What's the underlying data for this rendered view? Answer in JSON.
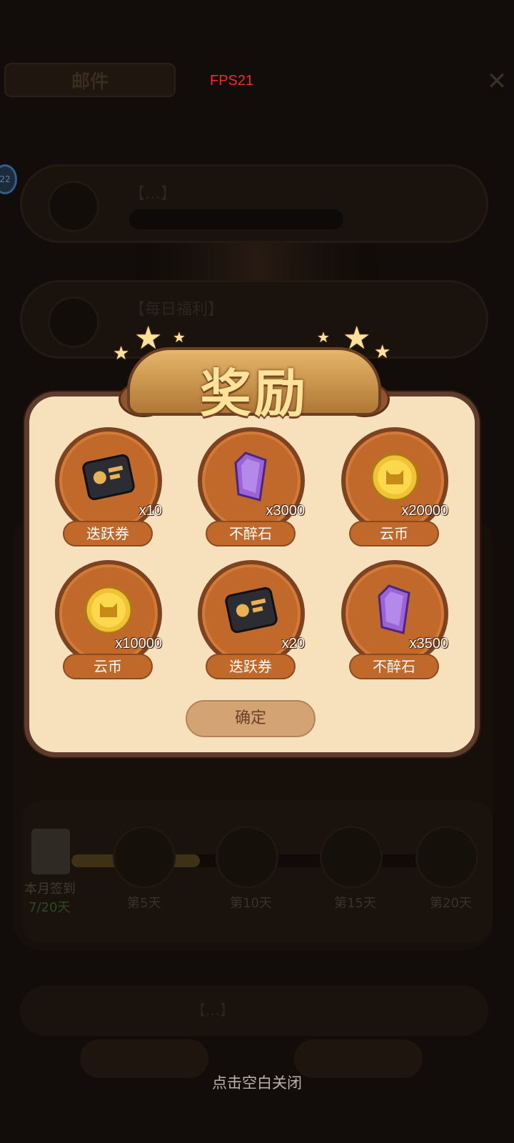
{
  "fps": "FPS21",
  "background": {
    "mail_tab": "邮件",
    "close_glyph": "✕",
    "badge": "22",
    "mail_rows": [
      {
        "title": "【…】"
      },
      {
        "title": "【每日福利】"
      }
    ],
    "signin": {
      "month_label": "本月签到",
      "count": "7/20天",
      "milestones": [
        "第5天",
        "第10天",
        "第15天",
        "第20天"
      ]
    },
    "bottom_row_title": "【…】"
  },
  "modal": {
    "title": "奖励",
    "rewards": [
      {
        "name": "迭跃券",
        "qty": "x10",
        "icon": "ticket-card-icon"
      },
      {
        "name": "不醉石",
        "qty": "x3000",
        "icon": "purple-gem-icon"
      },
      {
        "name": "云币",
        "qty": "x20000",
        "icon": "gold-coin-icon"
      },
      {
        "name": "云币",
        "qty": "x10000",
        "icon": "gold-coin-icon"
      },
      {
        "name": "迭跃券",
        "qty": "x20",
        "icon": "ticket-card-icon"
      },
      {
        "name": "不醉石",
        "qty": "x3500",
        "icon": "purple-gem-icon"
      }
    ],
    "confirm_label": "确定"
  },
  "close_hint": "点击空白关闭",
  "colors": {
    "modal_bg": "#f7e1bd",
    "modal_border": "#5e3b2b",
    "reward_disc": "#c0692a",
    "confirm_bg": "#d3a374",
    "fps": "#ee2b2b"
  }
}
